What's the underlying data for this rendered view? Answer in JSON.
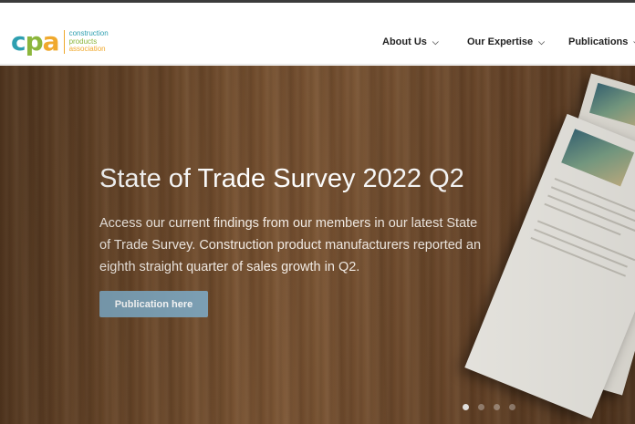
{
  "logo": {
    "mark": [
      "c",
      "p",
      "a"
    ],
    "lines": [
      "construction",
      "products",
      "association"
    ],
    "colors": {
      "teal": "#2e9fb0",
      "green": "#8cb63c",
      "orange": "#f0a92d"
    }
  },
  "nav": {
    "items": [
      {
        "label": "About Us",
        "icon": "chevron-down-icon"
      },
      {
        "label": "Our Expertise",
        "icon": "chevron-down-icon"
      },
      {
        "label": "Publications",
        "icon": "chevron-down-icon"
      }
    ]
  },
  "hero": {
    "title": "State of Trade Survey 2022 Q2",
    "description": "Access our current findings from our members in our latest State of Trade Survey. Construction product manufacturers reported an eighth straight quarter of sales growth in Q2.",
    "button_label": "Publication here",
    "button_color": "#7fa3b8",
    "carousel": {
      "slide_count": 4,
      "active_index": 0
    }
  }
}
